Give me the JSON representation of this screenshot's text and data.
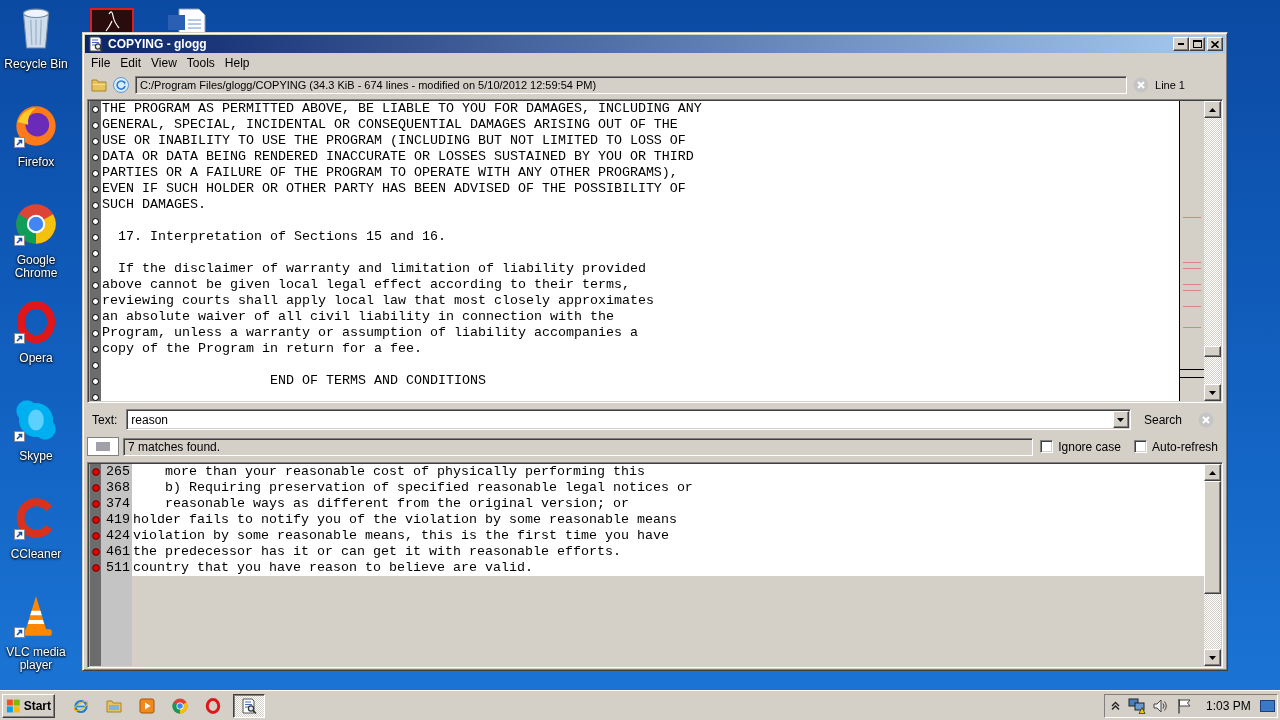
{
  "desktop": {
    "icons": [
      {
        "kind": "recycle-bin",
        "label": "Recycle Bin",
        "shortcut": false
      },
      {
        "kind": "firefox",
        "label": "Firefox",
        "shortcut": true
      },
      {
        "kind": "chrome",
        "label": "Google Chrome",
        "shortcut": true
      },
      {
        "kind": "opera",
        "label": "Opera",
        "shortcut": true
      },
      {
        "kind": "skype",
        "label": "Skype",
        "shortcut": true
      },
      {
        "kind": "ccleaner",
        "label": "CCleaner",
        "shortcut": true
      },
      {
        "kind": "vlc",
        "label": "VLC media player",
        "shortcut": true
      }
    ],
    "partly_hidden_icons": [
      {
        "kind": "pdf"
      },
      {
        "kind": "document"
      }
    ]
  },
  "window": {
    "title": "COPYING - glogg",
    "menu": [
      "File",
      "Edit",
      "View",
      "Tools",
      "Help"
    ],
    "toolbar": {
      "file_info": "C:/Program Files/glogg/COPYING (34.3 KiB - 674 lines - modified on 5/10/2012 12:59:54 PM)",
      "position": "Line 1"
    },
    "main_view": {
      "lines": [
        {
          "kind": "text",
          "text": "THE PROGRAM AS PERMITTED ABOVE, BE LIABLE TO YOU FOR DAMAGES, INCLUDING ANY"
        },
        {
          "kind": "text",
          "text": "GENERAL, SPECIAL, INCIDENTAL OR CONSEQUENTIAL DAMAGES ARISING OUT OF THE"
        },
        {
          "kind": "text",
          "text": "USE OR INABILITY TO USE THE PROGRAM (INCLUDING BUT NOT LIMITED TO LOSS OF"
        },
        {
          "kind": "text",
          "text": "DATA OR DATA BEING RENDERED INACCURATE OR LOSSES SUSTAINED BY YOU OR THIRD"
        },
        {
          "kind": "text",
          "text": "PARTIES OR A FAILURE OF THE PROGRAM TO OPERATE WITH ANY OTHER PROGRAMS),"
        },
        {
          "kind": "text",
          "text": "EVEN IF SUCH HOLDER OR OTHER PARTY HAS BEEN ADVISED OF THE POSSIBILITY OF"
        },
        {
          "kind": "text",
          "text": "SUCH DAMAGES."
        },
        {
          "kind": "blank"
        },
        {
          "kind": "text",
          "text": "  17. Interpretation of Sections 15 and 16."
        },
        {
          "kind": "blank"
        },
        {
          "kind": "text",
          "text": "  If the disclaimer of warranty and limitation of liability provided"
        },
        {
          "kind": "text",
          "text": "above cannot be given local legal effect according to their terms,"
        },
        {
          "kind": "text",
          "text": "reviewing courts shall apply local law that most closely approximates"
        },
        {
          "kind": "text",
          "text": "an absolute waiver of all civil liability in connection with the"
        },
        {
          "kind": "text",
          "text": "Program, unless a warranty or assumption of liability accompanies a"
        },
        {
          "kind": "text",
          "text": "copy of the Program in return for a fee."
        },
        {
          "kind": "blank"
        },
        {
          "kind": "text",
          "text": "                     END OF TERMS AND CONDITIONS"
        },
        {
          "kind": "blank"
        }
      ]
    },
    "search": {
      "label": "Text:",
      "value": "reason",
      "button": "Search"
    },
    "status": {
      "message": "7 matches found.",
      "options": [
        {
          "label": "Ignore case",
          "checked": false
        },
        {
          "label": "Auto-refresh",
          "checked": false
        }
      ]
    },
    "results": {
      "rows": [
        {
          "line": "265",
          "text": "    more than your reasonable cost of physically performing this"
        },
        {
          "line": "368",
          "text": "    b) Requiring preservation of specified reasonable legal notices or"
        },
        {
          "line": "374",
          "text": "    reasonable ways as different from the original version; or"
        },
        {
          "line": "419",
          "text": "holder fails to notify you of the violation by some reasonable means"
        },
        {
          "line": "424",
          "text": "violation by some reasonable means, this is the first time you have"
        },
        {
          "line": "461",
          "text": "the predecessor has it or can get it with reasonable efforts."
        },
        {
          "line": "511",
          "text": "country that you have reason to believe are valid."
        }
      ]
    }
  },
  "taskbar": {
    "start": "Start",
    "quick_launch": [
      {
        "kind": "ie"
      },
      {
        "kind": "explorer"
      },
      {
        "kind": "media-player"
      },
      {
        "kind": "chrome"
      },
      {
        "kind": "opera"
      }
    ],
    "tasks": [
      {
        "kind": "glogg",
        "selected": true
      }
    ],
    "clock": "1:03 PM"
  }
}
